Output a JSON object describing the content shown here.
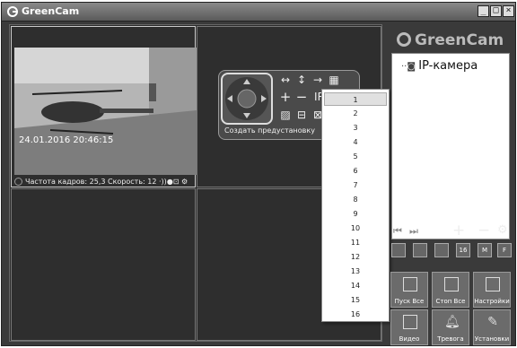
{
  "window": {
    "title": "GreenCam"
  },
  "video": {
    "timestamp": "24.01.2016 20:46:15",
    "status_text": "Частота кадров: 25,3     Скорость: 12"
  },
  "ptz": {
    "preset_label": "Создать предустановку",
    "ir_label": "IR"
  },
  "preset_dropdown": {
    "options": [
      "1",
      "2",
      "3",
      "4",
      "5",
      "6",
      "7",
      "8",
      "9",
      "10",
      "11",
      "12",
      "13",
      "14",
      "15",
      "16"
    ],
    "selected": "1"
  },
  "sidebar": {
    "logo": "GreenCam",
    "tree_item": "IP-камера",
    "layout_buttons": [
      "",
      "",
      "",
      "16",
      "M",
      "F"
    ],
    "buttons": {
      "start_all": "Пуск Все",
      "stop_all": "Стоп Все",
      "settings": "Настройки",
      "video": "Видео",
      "alarm": "Тревога",
      "setup": "Установки"
    }
  }
}
